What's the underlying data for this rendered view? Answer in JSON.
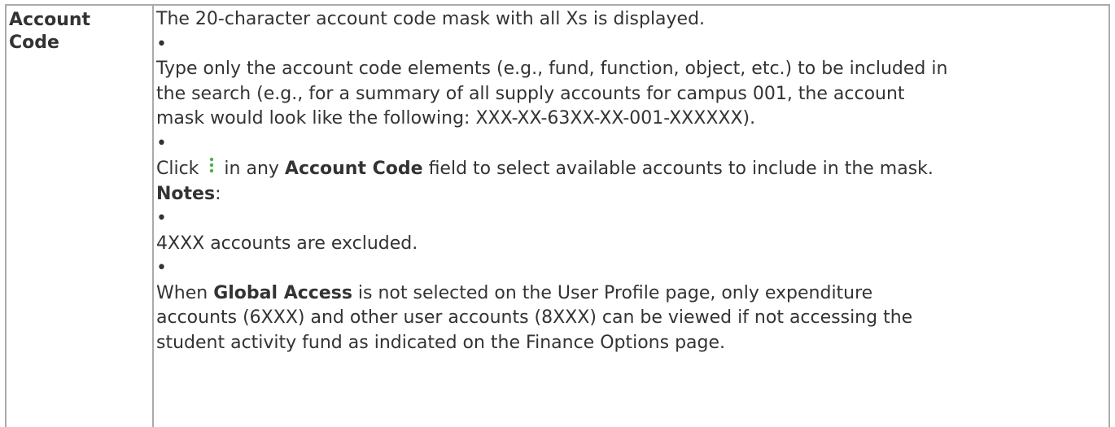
{
  "term": {
    "line1": "Account",
    "line2": "Code"
  },
  "description": {
    "intro": "The 20-character account code mask with all Xs is displayed.",
    "bullet": "•",
    "type_line1": "Type only the account code elements (e.g., fund, function, object, etc.) to be included in",
    "type_line2": "the search (e.g., for a summary of all supply accounts for campus 001, the account",
    "type_line3": "mask would look like the following: XXX-XX-63XX-XX-001-XXXXXX).",
    "click_prefix": "Click",
    "click_middle": "in any",
    "click_bold": "Account Code",
    "click_suffix": "field to select available accounts to include in the mask.",
    "notes_label": "Notes",
    "notes_colon": ":",
    "exclusion": "4XXX accounts are excluded.",
    "global_prefix": "When",
    "global_bold": "Global Access",
    "global_line1_suffix": "is not selected on the User Profile page, only expenditure",
    "global_line2": "accounts (6XXX) and other user accounts (8XXX) can be viewed if not accessing the",
    "global_line3": "student activity fund as indicated on the Finance Options page."
  },
  "icons": {
    "lookup": "vertical-dots-icon",
    "lookup_color": "#4caf50"
  }
}
